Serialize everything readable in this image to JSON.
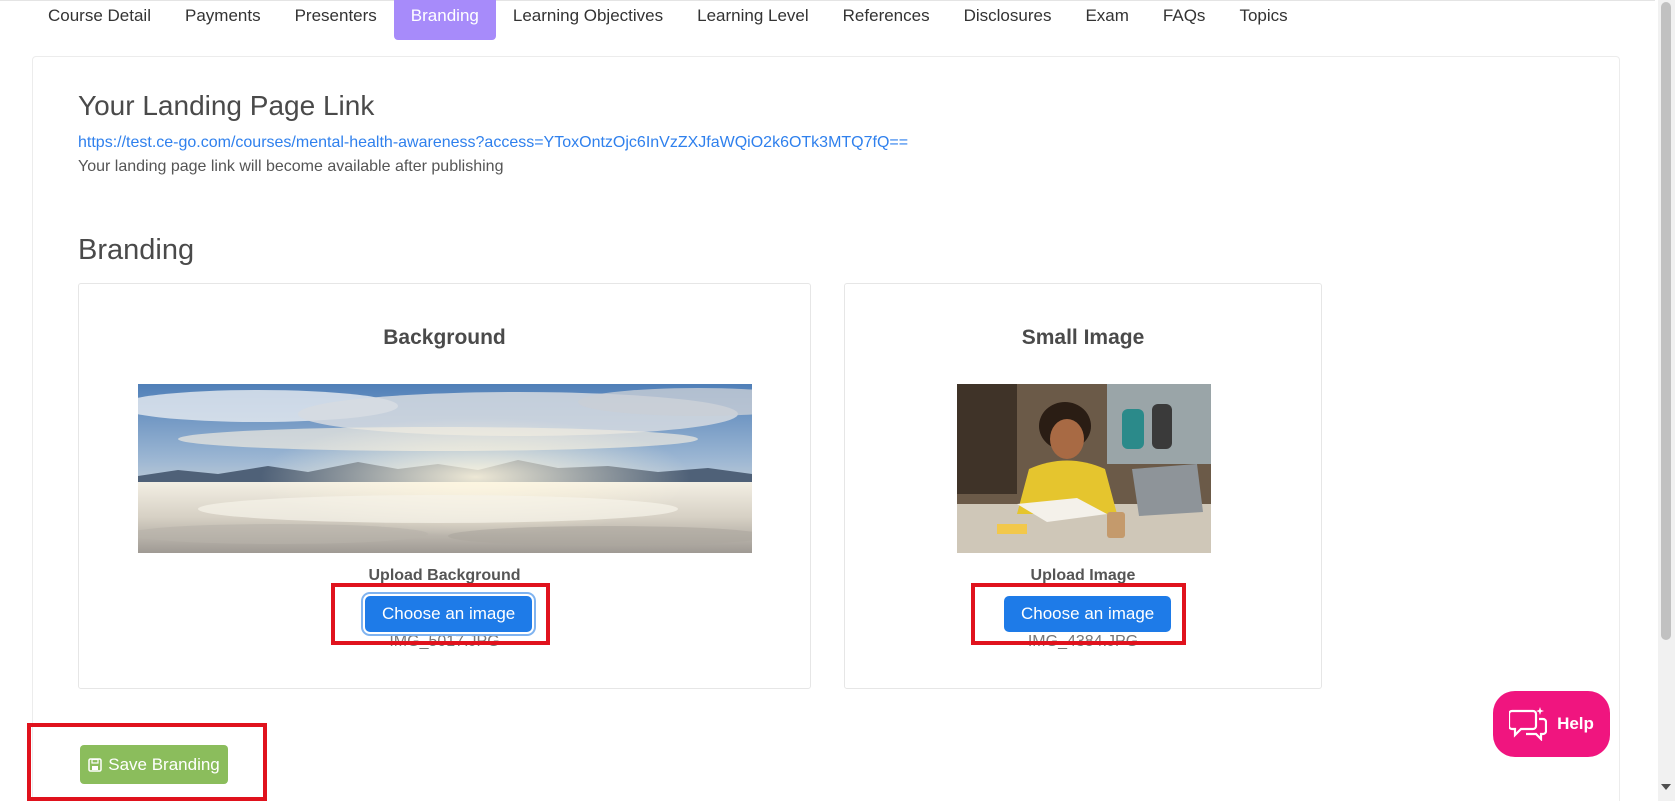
{
  "tabs": [
    {
      "label": "Course Detail"
    },
    {
      "label": "Payments"
    },
    {
      "label": "Presenters"
    },
    {
      "label": "Branding",
      "active": true
    },
    {
      "label": "Learning Objectives"
    },
    {
      "label": "Learning Level"
    },
    {
      "label": "References"
    },
    {
      "label": "Disclosures"
    },
    {
      "label": "Exam"
    },
    {
      "label": "FAQs"
    },
    {
      "label": "Topics"
    }
  ],
  "landing": {
    "title": "Your Landing Page Link",
    "link": "https://test.ce-go.com/courses/mental-health-awareness?access=YToxOntzOjc6InVzZXJfaWQiO2k6OTk3MTQ7fQ==",
    "note": "Your landing page link will become available after publishing"
  },
  "branding": {
    "title": "Branding",
    "background": {
      "title": "Background",
      "upload_label": "Upload Background",
      "button_label": "Choose an image",
      "file_name": "IMG_5017.JPG"
    },
    "small_image": {
      "title": "Small Image",
      "upload_label": "Upload Image",
      "button_label": "Choose an image",
      "file_name": "IMG_4384.JPG"
    },
    "save_label": "Save Branding"
  },
  "help": {
    "label": "Help"
  },
  "colors": {
    "active_tab": "#a78bfa",
    "link": "#2f80ed",
    "primary_button": "#1e7be8",
    "save_button": "#8bbd5c",
    "help_button": "#f0157f",
    "highlight_box": "#e0121d"
  },
  "icons": {
    "save": "floppy-disk-icon",
    "help": "chat-bubbles-icon"
  }
}
